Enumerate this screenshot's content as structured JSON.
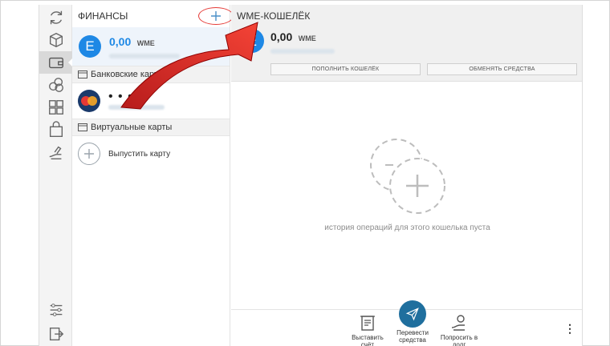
{
  "list": {
    "title": "ФИНАНСЫ",
    "wallet": {
      "avatar_letter": "E",
      "amount": "0,00",
      "currency": "WME"
    },
    "bank_section": "Банковские карты",
    "card_mask": "• • •",
    "virtual_section": "Виртуальные карты",
    "issue_label": "Выпустить карту"
  },
  "main": {
    "title": "WME-КОШЕЛЁК",
    "wallet": {
      "avatar_letter": "E",
      "amount": "0,00",
      "currency": "WME"
    },
    "topup_label": "ПОПОЛНИТЬ КОШЕЛЁК",
    "exchange_label": "ОБМЕНЯТЬ СРЕДСТВА",
    "empty_text": "история операций для этого кошелька пуста"
  },
  "bottom": {
    "invoice_label": "Выставить счёт",
    "transfer_label": "Перевести средства",
    "borrow_label": "Попросить в долг",
    "more": "⋮"
  },
  "colors": {
    "accent": "#1e88e5",
    "send": "#1f6f9e",
    "highlight": "#e53935"
  },
  "icons": {
    "rail": [
      "refresh-icon",
      "box-icon",
      "wallet-icon",
      "coins-icon",
      "exchange-icon",
      "shop-icon",
      "hand-icon"
    ],
    "rail_bottom": [
      "settings-sliders-icon",
      "logout-icon"
    ]
  }
}
